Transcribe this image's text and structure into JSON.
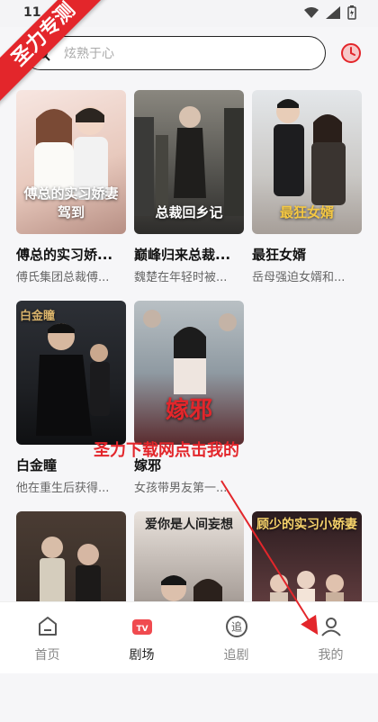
{
  "status_bar": {
    "time": "11"
  },
  "watermark": {
    "ribbon_text": "圣力专测",
    "overlay_text": "圣力下载网点击我的"
  },
  "search": {
    "placeholder": "炫熟于心"
  },
  "dramas": [
    {
      "title": "傅总的实习娇...",
      "desc": "傅氏集团总裁傅...",
      "poster_text": "傅总的实习娇妻驾到"
    },
    {
      "title": "巅峰归来总裁...",
      "desc": "魏楚在年轻时被...",
      "poster_text": "总裁回乡记"
    },
    {
      "title": "最狂女婿",
      "desc": "岳母强迫女婿和...",
      "poster_text": "最狂女婿"
    },
    {
      "title": "白金瞳",
      "desc": "他在重生后获得...",
      "poster_text": "白金瞳"
    },
    {
      "title": "嫁邪",
      "desc": "女孩带男友第一...",
      "poster_text": "嫁邪"
    },
    {
      "title": "",
      "desc": "",
      "poster_text": ""
    },
    {
      "title": "",
      "desc": "",
      "poster_text": "爱你是人间妄想"
    },
    {
      "title": "",
      "desc": "",
      "poster_text": "顾少的实习小娇妻"
    }
  ],
  "nav": [
    {
      "label": "首页",
      "icon": "home-icon"
    },
    {
      "label": "剧场",
      "icon": "tv-icon"
    },
    {
      "label": "追剧",
      "icon": "follow-icon"
    },
    {
      "label": "我的",
      "icon": "profile-icon"
    }
  ],
  "colors": {
    "accent": "#e3262b",
    "nav_active": "#222222",
    "nav_inactive": "#888888"
  }
}
